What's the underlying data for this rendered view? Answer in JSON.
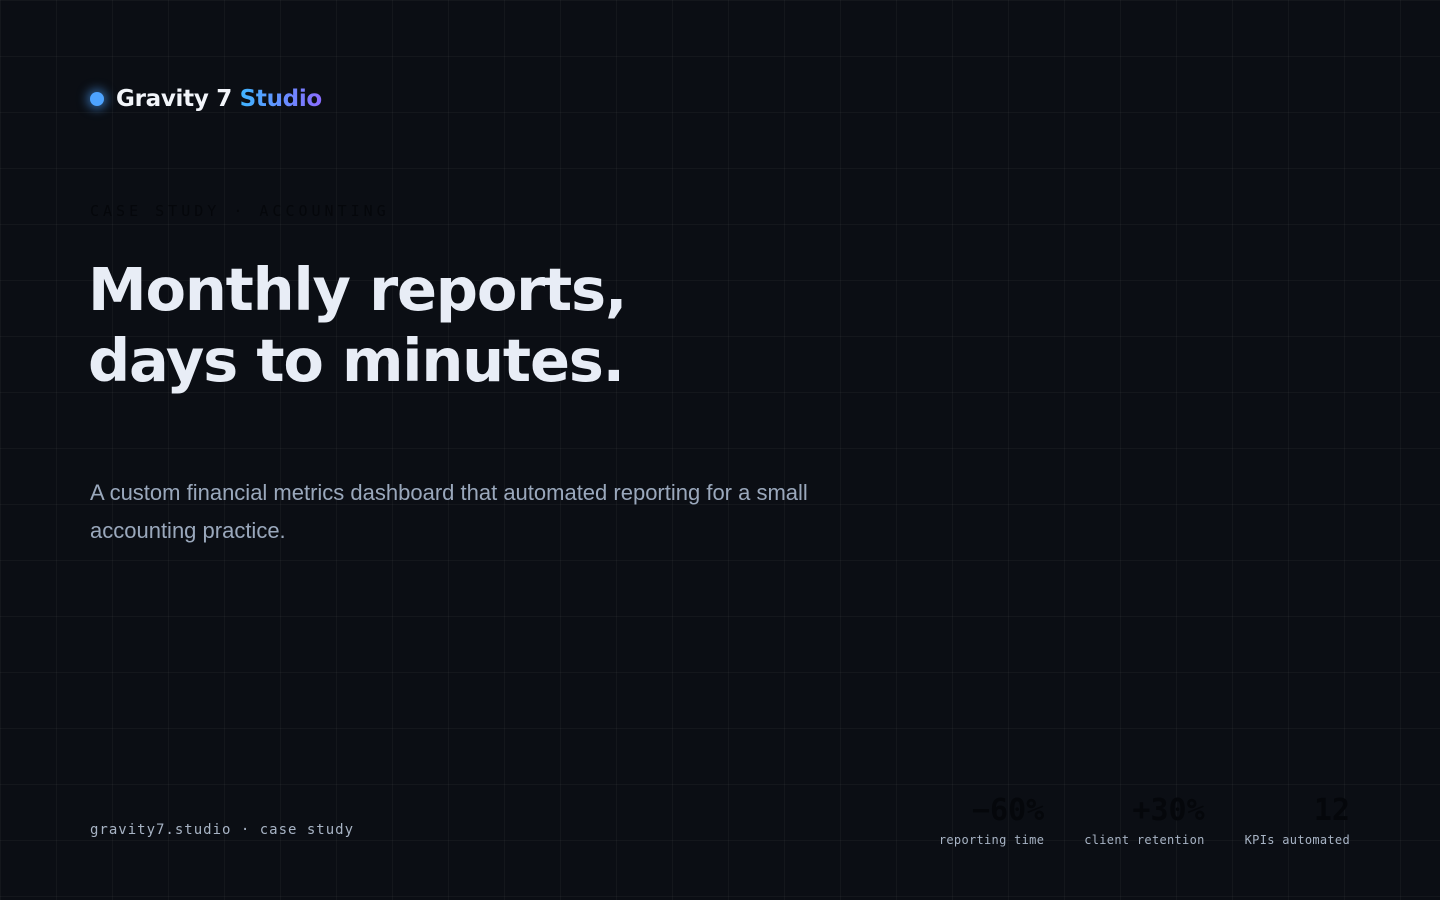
{
  "brand": {
    "name": "Gravity 7",
    "accent": "Studio",
    "dot_color": "#4da3ff",
    "accent_gradient": [
      "#3fb4ff",
      "#8a6cff"
    ]
  },
  "hero": {
    "eyebrow": "CASE STUDY · ACCOUNTING",
    "headline_line1": "Monthly reports,",
    "headline_line2": "days to minutes.",
    "lede": "A custom financial metrics dashboard that automated reporting for a small accounting practice."
  },
  "footer": {
    "note": "gravity7.studio · case study"
  },
  "stats": [
    {
      "value": "−60%",
      "label": "reporting time"
    },
    {
      "value": "+30%",
      "label": "client retention"
    },
    {
      "value": "12",
      "label": "KPIs automated"
    }
  ],
  "colors": {
    "background": "#0b0e14",
    "headline": "#e8edf6",
    "body_text": "#9aa8bc"
  }
}
